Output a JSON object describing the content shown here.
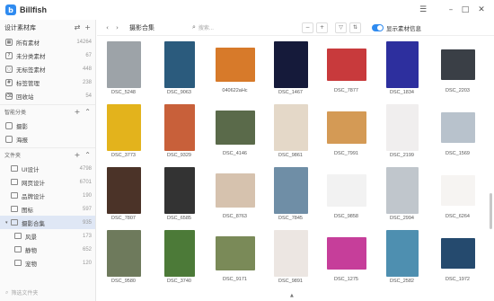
{
  "app": {
    "name": "Billfish"
  },
  "sidebar": {
    "library_title": "设计素材库",
    "items": [
      {
        "label": "所有素材",
        "count": "14264",
        "icon": "grid-icon"
      },
      {
        "label": "未分类素材",
        "count": "67",
        "icon": "unclassified-icon"
      },
      {
        "label": "无标签素材",
        "count": "448",
        "icon": "untagged-icon"
      },
      {
        "label": "标签管理",
        "count": "238",
        "icon": "tag-icon"
      },
      {
        "label": "回收站",
        "count": "54",
        "icon": "trash-icon"
      }
    ],
    "smart_title": "智能分类",
    "smart_items": [
      {
        "label": "摄影"
      },
      {
        "label": "海报"
      }
    ],
    "folders_title": "文件夹",
    "folders": [
      {
        "label": "UI设计",
        "count": "4798"
      },
      {
        "label": "网页设计",
        "count": "6701"
      },
      {
        "label": "品牌设计",
        "count": "190"
      },
      {
        "label": "图标",
        "count": "597"
      },
      {
        "label": "摄影合集",
        "count": "935",
        "active": true
      }
    ],
    "subfolders": [
      {
        "label": "风景",
        "count": "173"
      },
      {
        "label": "静物",
        "count": "652"
      },
      {
        "label": "宠物",
        "count": "120"
      }
    ],
    "filter_placeholder": "筛选文件夹"
  },
  "toolbar": {
    "breadcrumb": "摄影合集",
    "search_placeholder": "搜索...",
    "show_info_label": "显示素材信息"
  },
  "thumbnails": [
    {
      "name": "DSC_5248",
      "color": "#9da3a8"
    },
    {
      "name": "DSC_9063",
      "color": "#2b5b7d"
    },
    {
      "name": "040622aHc",
      "color": "#d77a2a"
    },
    {
      "name": "DSC_1467",
      "color": "#151a3a"
    },
    {
      "name": "DSC_7877",
      "color": "#c83a3c"
    },
    {
      "name": "DSC_1834",
      "color": "#2d2f9e"
    },
    {
      "name": "DSC_2203",
      "color": "#3a3f46"
    },
    {
      "name": "DSC_3773",
      "color": "#e3b31c"
    },
    {
      "name": "DSC_9329",
      "color": "#c8603a"
    },
    {
      "name": "DSC_4146",
      "color": "#5a6a4a"
    },
    {
      "name": "DSC_9861",
      "color": "#e4d8c8"
    },
    {
      "name": "DSC_7991",
      "color": "#d49a55"
    },
    {
      "name": "DSC_2199",
      "color": "#f0eeee"
    },
    {
      "name": "DSC_1569",
      "color": "#b8c2cc"
    },
    {
      "name": "DSC_7807",
      "color": "#4b3328"
    },
    {
      "name": "DSC_6585",
      "color": "#333333"
    },
    {
      "name": "DSC_8763",
      "color": "#d6c2ae"
    },
    {
      "name": "DSC_7845",
      "color": "#6f8ea6"
    },
    {
      "name": "DSC_9858",
      "color": "#f2f2f2"
    },
    {
      "name": "DSC_2994",
      "color": "#c0c6cc"
    },
    {
      "name": "DSC_6264",
      "color": "#f6f4f2"
    },
    {
      "name": "DSC_9580",
      "color": "#6e7a5c"
    },
    {
      "name": "DSC_3740",
      "color": "#4c7a38"
    },
    {
      "name": "DSC_9171",
      "color": "#7a8a58"
    },
    {
      "name": "DSC_9891",
      "color": "#ece6e2"
    },
    {
      "name": "DSC_1275",
      "color": "#c63e9a"
    },
    {
      "name": "DSC_2582",
      "color": "#4e8fb0"
    },
    {
      "name": "DSC_1972",
      "color": "#254a6e"
    }
  ]
}
